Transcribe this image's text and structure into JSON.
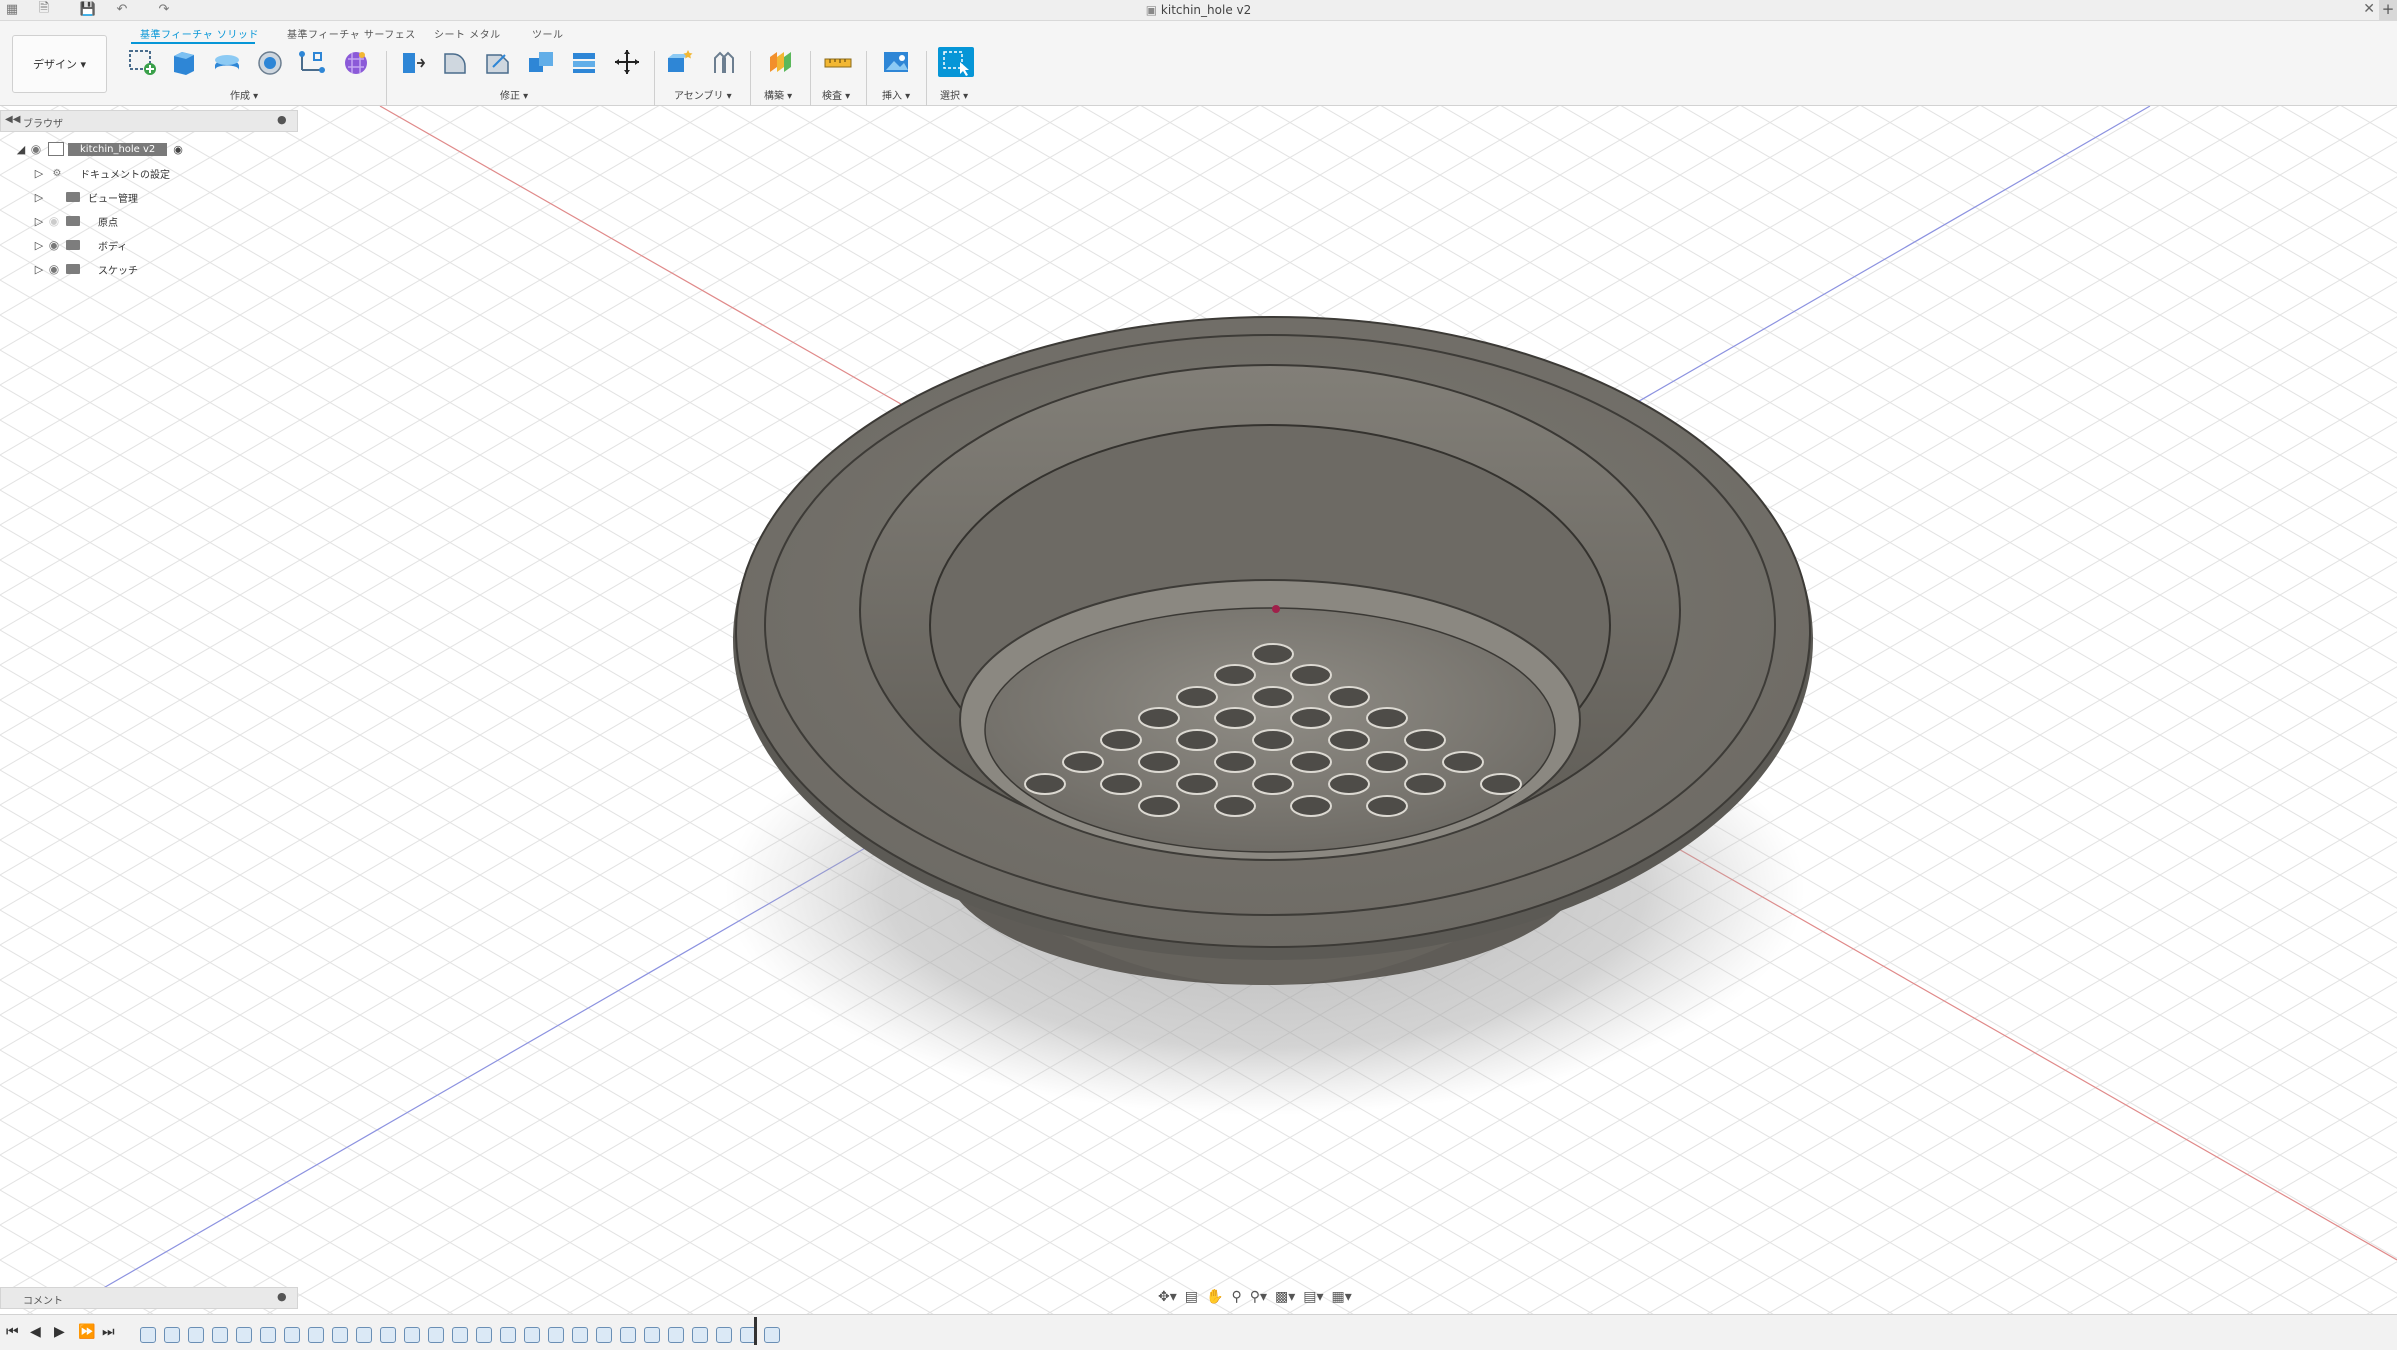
{
  "titlebar": {
    "title": "kitchin_hole v2",
    "icons": [
      "app-grid-icon",
      "file-menu-icon",
      "save-icon",
      "undo-icon",
      "redo-icon",
      "close-icon",
      "new-tab-icon"
    ]
  },
  "ribbon": {
    "tabs": [
      "基準フィーチャ ソリッド",
      "基準フィーチャ サーフェス",
      "シート メタル",
      "ツール"
    ],
    "active_tab": "基準フィーチャ ソリッド",
    "workspace": "デザイン ▾",
    "groups": {
      "create": "作成 ▾",
      "modify": "修正 ▾",
      "assemble": "アセンブリ ▾",
      "construct": "構築 ▾",
      "inspect": "検査 ▾",
      "insert": "挿入 ▾",
      "select": "選択 ▾"
    },
    "accent": "#0696d7"
  },
  "browser": {
    "header": "ブラウザ",
    "root": "kitchin_hole v2",
    "items": [
      "ドキュメントの設定",
      "ビュー管理",
      "原点",
      "ボディ",
      "スケッチ"
    ]
  },
  "comments": {
    "header": "コメント"
  },
  "timeline": {
    "feature_count": 27
  }
}
